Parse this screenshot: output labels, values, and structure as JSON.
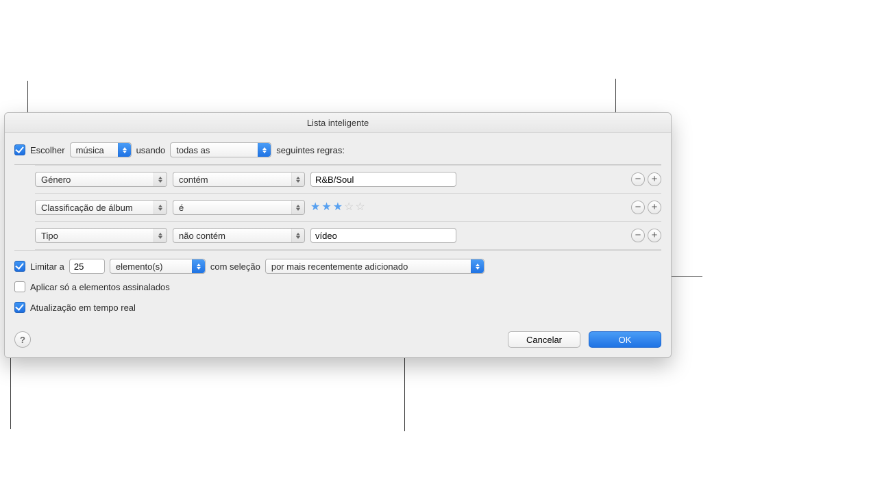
{
  "title": "Lista inteligente",
  "match": {
    "checkbox_label": "Escolher",
    "media_select": "música",
    "using_label": "usando",
    "quantifier_select": "todas as",
    "trailing_label": "seguintes regras:"
  },
  "rules": [
    {
      "field": "Género",
      "op": "contém",
      "value": "R&B/Soul",
      "kind": "text"
    },
    {
      "field": "Classificação de álbum",
      "op": "é",
      "kind": "stars",
      "stars": 3
    },
    {
      "field": "Tipo",
      "op": "não contém",
      "value": "vídeo",
      "kind": "text"
    }
  ],
  "limit": {
    "label": "Limitar a",
    "count": "25",
    "unit_select": "elemento(s)",
    "by_label": "com seleção",
    "order_select": "por mais recentemente adicionado"
  },
  "only_checked_label": "Aplicar só a elementos assinalados",
  "live_update_label": "Atualização em tempo real",
  "buttons": {
    "cancel": "Cancelar",
    "ok": "OK"
  },
  "help_glyph": "?",
  "star_glyph": "★",
  "star_empty_glyph": "☆",
  "minus_glyph": "−",
  "plus_glyph": "+"
}
